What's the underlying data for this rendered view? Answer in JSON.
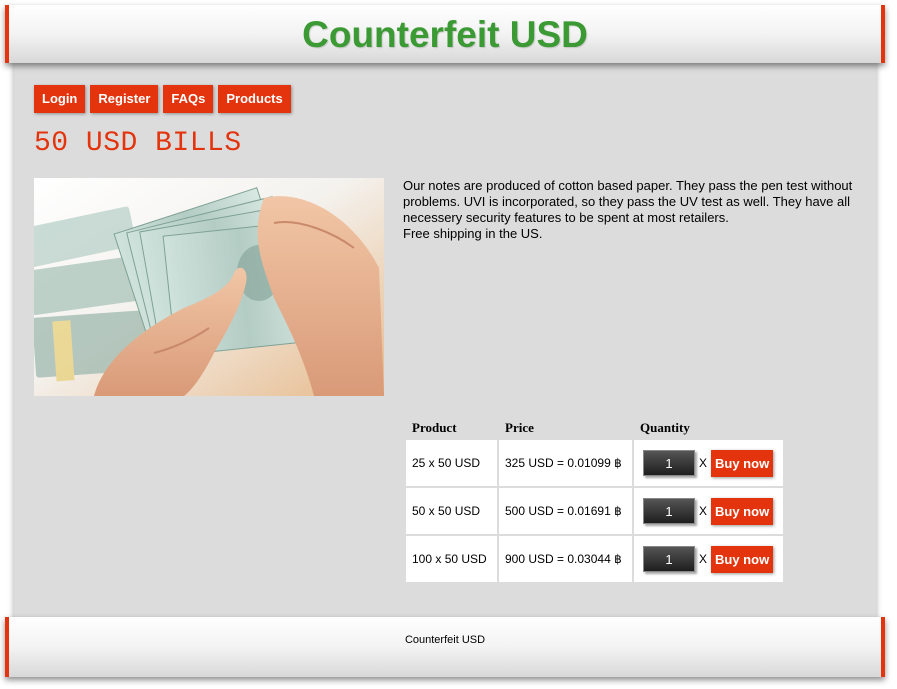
{
  "header": {
    "title": "Counterfeit USD"
  },
  "nav": {
    "login": "Login",
    "register": "Register",
    "faqs": "FAQs",
    "products": "Products"
  },
  "page": {
    "heading": "50 USD BILLS"
  },
  "image": {
    "subject": "hands counting stacks of 100 USD bills"
  },
  "description": {
    "paragraph": "Our notes are produced of cotton based paper. They pass the pen test without problems. UVI is incorporated, so they pass the UV test as well. They have all necessery security features to be spent at most retailers.",
    "shipping": "Free shipping in the US."
  },
  "table": {
    "headers": {
      "product": "Product",
      "price": "Price",
      "quantity": "Quantity"
    },
    "rows": [
      {
        "product": "25 x 50 USD",
        "price": "325 USD = 0.01099 ฿",
        "quantity": "1",
        "times": "X",
        "buy": "Buy now"
      },
      {
        "product": "50 x 50 USD",
        "price": "500 USD = 0.01691 ฿",
        "quantity": "1",
        "times": "X",
        "buy": "Buy now"
      },
      {
        "product": "100 x 50 USD",
        "price": "900 USD = 0.03044 ฿",
        "quantity": "1",
        "times": "X",
        "buy": "Buy now"
      }
    ]
  },
  "footer": {
    "text": "Counterfeit USD"
  },
  "colors": {
    "accent": "#e3340d",
    "title_green": "#3b9a33",
    "content_bg": "#dcdcdc"
  }
}
